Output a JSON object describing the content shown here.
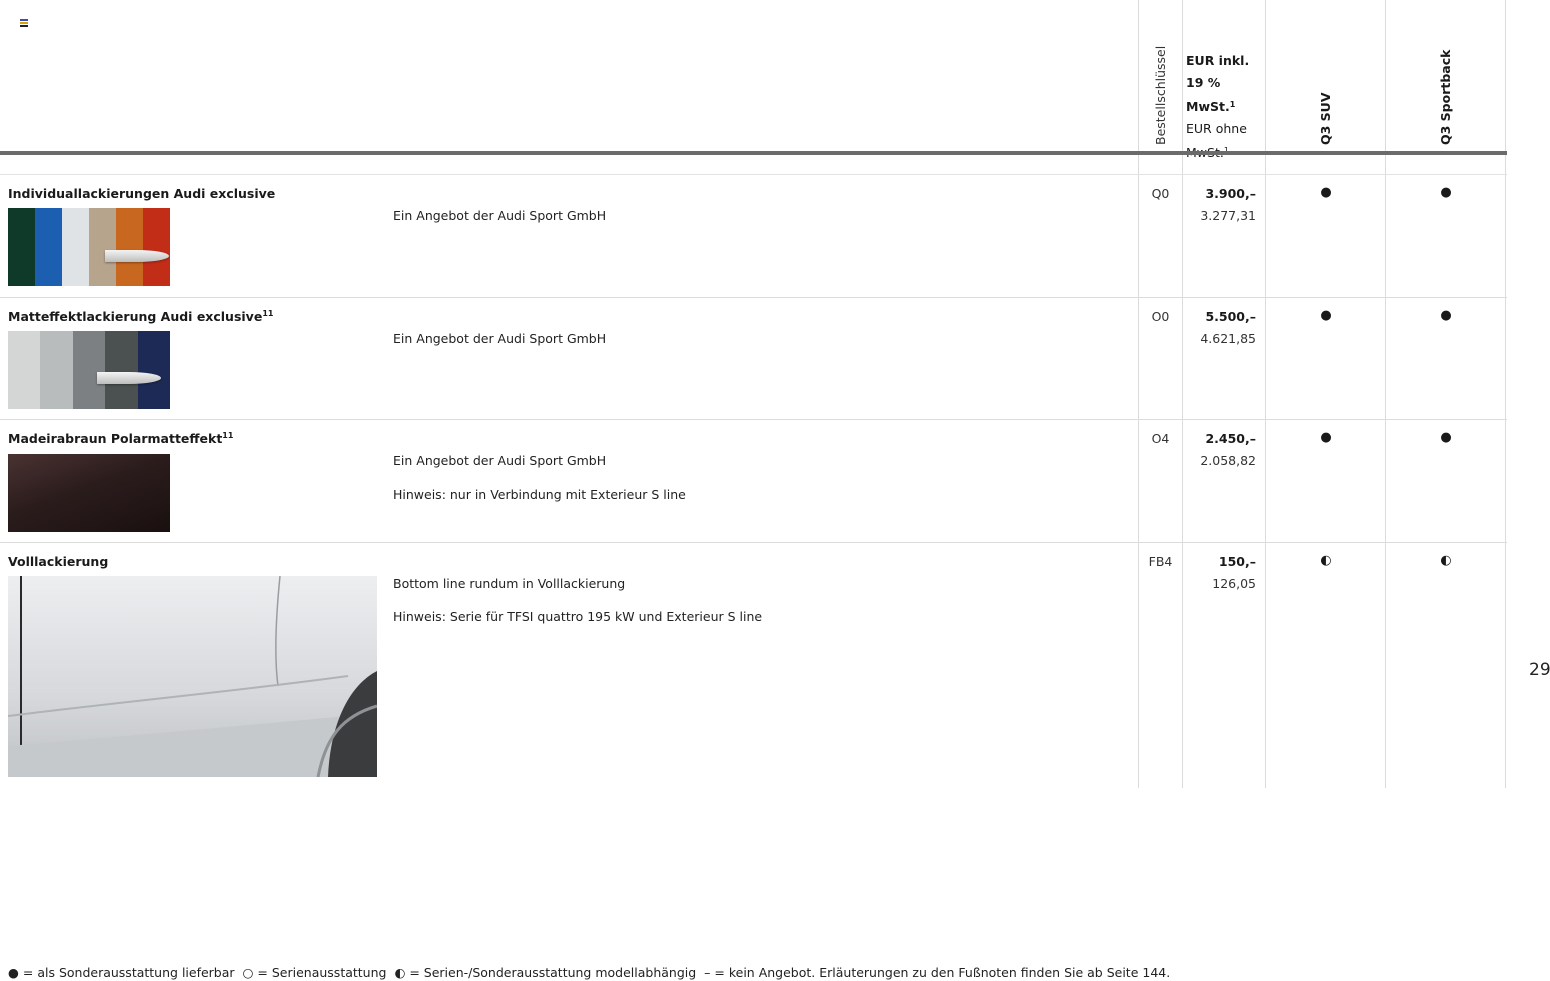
{
  "header": {
    "code_label": "Bestellschlüssel",
    "price_inkl_label": "EUR inkl. 19 % MwSt.",
    "price_inkl_note": "1",
    "price_ohne_label": "EUR ohne MwSt.",
    "price_ohne_note": "1",
    "model_1": "Q3 SUV",
    "model_2": "Q3 Sportback"
  },
  "rows": [
    {
      "title": "Individuallackierungen Audi exclusive",
      "footnote": "",
      "descriptions": [
        "Ein Angebot der Audi Sport GmbH"
      ],
      "code": "Q0",
      "price_inkl": "3.900,–",
      "price_ohne": "3.277,31",
      "suv": "●",
      "sportback": "●",
      "swatch_colors": [
        "#0f3a2a",
        "#1c5fb0",
        "#dfe3e6",
        "#b7a48c",
        "#c8671f",
        "#c22d18"
      ]
    },
    {
      "title": "Matteffektlackierung Audi exclusive",
      "footnote": "11",
      "descriptions": [
        "Ein Angebot der Audi Sport GmbH"
      ],
      "code": "O0",
      "price_inkl": "5.500,–",
      "price_ohne": "4.621,85",
      "suv": "●",
      "sportback": "●",
      "swatch_colors": [
        "#d3d6d4",
        "#b8bcbd",
        "#7c8082",
        "#4b5150",
        "#1d2a55"
      ]
    },
    {
      "title": "Madeirabraun Polarmatteffekt",
      "footnote": "11",
      "descriptions": [
        "Ein Angebot der Audi Sport GmbH",
        "Hinweis: nur in Verbindung mit Exterieur S line"
      ],
      "code": "O4",
      "price_inkl": "2.450,–",
      "price_ohne": "2.058,82",
      "suv": "●",
      "sportback": "●",
      "swatch_colors": [
        "#2b1c1c"
      ]
    },
    {
      "title": "Volllackierung",
      "footnote": "",
      "descriptions": [
        "Bottom line rundum in Volllackierung",
        "Hinweis: Serie für TFSI quattro 195 kW und Exterieur S line"
      ],
      "code": "FB4",
      "price_inkl": "150,–",
      "price_ohne": "126,05",
      "suv": "◐",
      "sportback": "◐"
    }
  ],
  "page_number": "29",
  "legend": {
    "filled": "● = als Sonderausstattung lieferbar",
    "open": "○ = Serienausstattung",
    "half": "◐ = Serien-/Sonderausstattung modellabhängig",
    "dash": "– = kein Angebot. Erläuterungen zu den Fußnoten finden Sie ab Seite 144."
  }
}
